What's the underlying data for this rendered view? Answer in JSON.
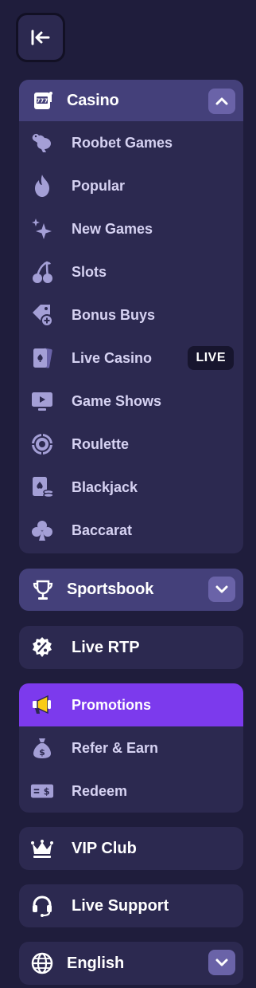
{
  "casino": {
    "title": "Casino",
    "items": [
      {
        "label": "Roobet Games",
        "icon": "kangaroo-icon"
      },
      {
        "label": "Popular",
        "icon": "flame-icon"
      },
      {
        "label": "New Games",
        "icon": "sparkles-icon"
      },
      {
        "label": "Slots",
        "icon": "cherries-icon"
      },
      {
        "label": "Bonus Buys",
        "icon": "tag-plus-icon"
      },
      {
        "label": "Live Casino",
        "icon": "playing-cards-icon",
        "badge": "LIVE"
      },
      {
        "label": "Game Shows",
        "icon": "monitor-play-icon"
      },
      {
        "label": "Roulette",
        "icon": "roulette-wheel-icon"
      },
      {
        "label": "Blackjack",
        "icon": "card-chips-icon"
      },
      {
        "label": "Baccarat",
        "icon": "club-suit-icon"
      }
    ]
  },
  "sportsbook": {
    "title": "Sportsbook"
  },
  "live_rtp": {
    "label": "Live RTP"
  },
  "promos": {
    "items": [
      {
        "label": "Promotions",
        "icon": "megaphone-icon",
        "active": true
      },
      {
        "label": "Refer & Earn",
        "icon": "money-bag-icon"
      },
      {
        "label": "Redeem",
        "icon": "voucher-icon"
      }
    ]
  },
  "vip": {
    "label": "VIP Club"
  },
  "support": {
    "label": "Live Support"
  },
  "language": {
    "label": "English"
  },
  "colors": {
    "background": "#1f1d3c",
    "card": "#2c2950",
    "header": "#44407a",
    "active": "#7c3aed",
    "icon": "#a49fd6"
  }
}
